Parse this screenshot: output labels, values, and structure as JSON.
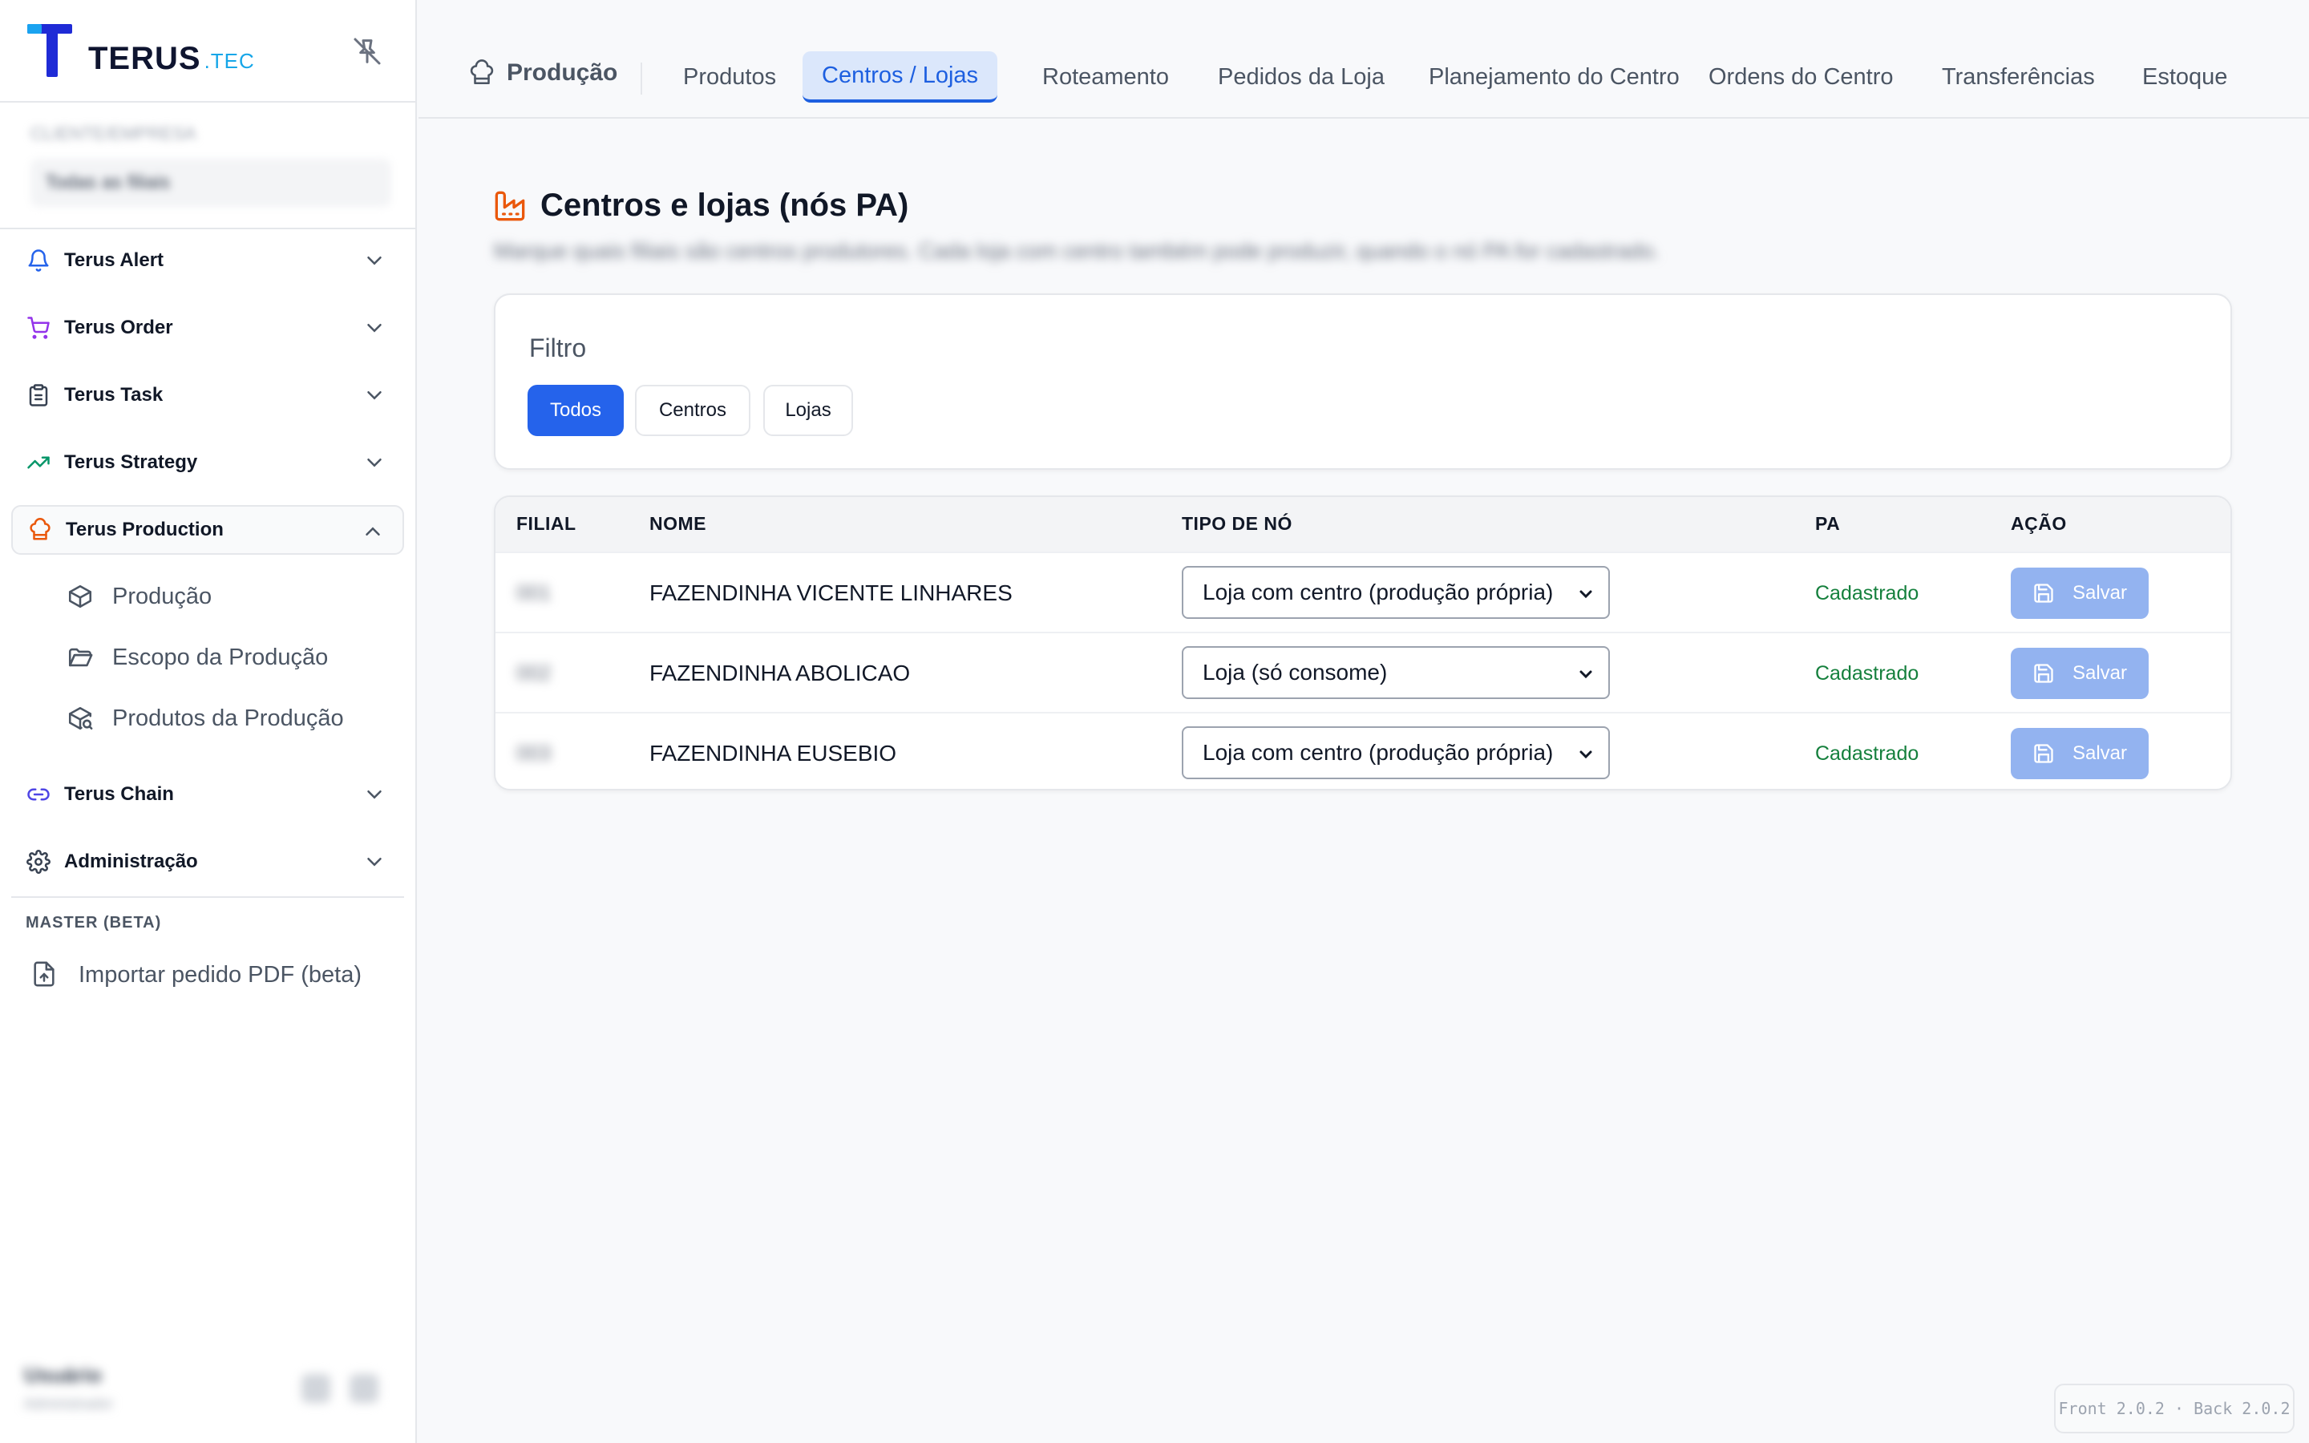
{
  "brand": {
    "name": "TERUS",
    "suffix": ".TEC"
  },
  "sidebar": {
    "company_label": "CLIENTE/EMPRESA",
    "company_value": "Todas as filiais",
    "items": [
      {
        "label": "Terus Alert",
        "icon": "bell-icon",
        "color": "#2563eb"
      },
      {
        "label": "Terus Order",
        "icon": "cart-icon",
        "color": "#9333ea"
      },
      {
        "label": "Terus Task",
        "icon": "clipboard-icon",
        "color": "#374151"
      },
      {
        "label": "Terus Strategy",
        "icon": "trend-icon",
        "color": "#059669"
      },
      {
        "label": "Terus Production",
        "icon": "chef-hat-icon",
        "color": "#ea580c"
      },
      {
        "label": "Terus Chain",
        "icon": "link-icon",
        "color": "#4f46e5"
      },
      {
        "label": "Administração",
        "icon": "gear-icon",
        "color": "#374151"
      }
    ],
    "production_sub": [
      {
        "label": "Produção",
        "icon": "box-icon"
      },
      {
        "label": "Escopo da Produção",
        "icon": "folder-icon"
      },
      {
        "label": "Produtos da Produção",
        "icon": "package-search-icon"
      }
    ],
    "master_label": "MASTER (BETA)",
    "import_label": "Importar pedido PDF (beta)",
    "user_name": "Usuário",
    "user_role": "Administrador"
  },
  "tabs": {
    "home": "Produção",
    "items": [
      {
        "label": "Produtos",
        "active": false
      },
      {
        "label": "Centros / Lojas",
        "active": true
      },
      {
        "label": "Roteamento",
        "active": false
      },
      {
        "label": "Pedidos da Loja",
        "active": false
      },
      {
        "label": "Planejamento do Centro",
        "active": false
      },
      {
        "label": "Ordens do Centro",
        "active": false
      },
      {
        "label": "Transferências",
        "active": false
      },
      {
        "label": "Estoque",
        "active": false
      }
    ]
  },
  "page": {
    "title": "Centros e lojas (nós PA)",
    "description": "Marque quais filiais são centros produtores. Cada loja com centro também pode produzir, quando o nó PA for cadastrado."
  },
  "filter": {
    "title": "Filtro",
    "options": [
      {
        "label": "Todos",
        "active": true
      },
      {
        "label": "Centros",
        "active": false
      },
      {
        "label": "Lojas",
        "active": false
      }
    ]
  },
  "table": {
    "headers": {
      "filial": "FILIAL",
      "nome": "NOME",
      "tipo": "TIPO DE NÓ",
      "pa": "PA",
      "acao": "AÇÃO"
    },
    "rows": [
      {
        "filial": "001",
        "nome": "FAZENDINHA VICENTE LINHARES",
        "tipo": "Loja com centro (produção própria)",
        "pa": "Cadastrado",
        "acao": "Salvar"
      },
      {
        "filial": "002",
        "nome": "FAZENDINHA ABOLICAO",
        "tipo": "Loja (só consome)",
        "pa": "Cadastrado",
        "acao": "Salvar"
      },
      {
        "filial": "003",
        "nome": "FAZENDINHA EUSEBIO",
        "tipo": "Loja com centro (produção própria)",
        "pa": "Cadastrado",
        "acao": "Salvar"
      }
    ]
  },
  "version": "Front 2.0.2 · Back 2.0.2",
  "colors": {
    "primary": "#2563eb",
    "success": "#15803d",
    "accent_orange": "#ea580c"
  }
}
